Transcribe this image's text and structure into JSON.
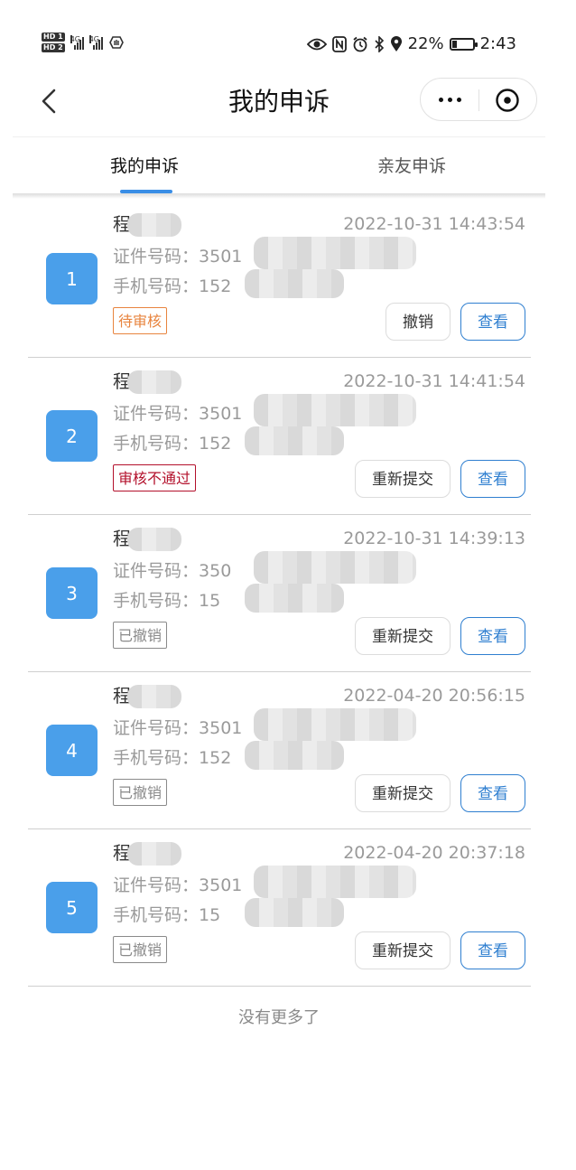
{
  "status_bar": {
    "hd1": "HD 1",
    "hd2": "HD 2",
    "net1": "4G",
    "net2": "4G",
    "battery_percent": "22%",
    "battery_level": 0.22,
    "time": "2:43",
    "icons": [
      "eye-icon",
      "nfc-icon",
      "alarm-icon",
      "bluetooth-icon",
      "location-icon",
      "battery-icon"
    ]
  },
  "nav": {
    "title": "我的申诉",
    "icons": [
      "back-chevron-icon",
      "more-dots-icon",
      "close-circle-icon"
    ]
  },
  "tabs": [
    {
      "label": "我的申诉",
      "active": true
    },
    {
      "label": "亲友申诉",
      "active": false
    }
  ],
  "items": [
    {
      "index": "1",
      "name": "程",
      "time": "2022-10-31 14:43:54",
      "id_label": "证件号码：",
      "id_value": "3501",
      "phone_label": "手机号码：",
      "phone_value": "152",
      "status": "待审核",
      "buttons": [
        "撤销",
        "查看"
      ]
    },
    {
      "index": "2",
      "name": "程",
      "time": "2022-10-31 14:41:54",
      "id_label": "证件号码：",
      "id_value": "3501",
      "phone_label": "手机号码：",
      "phone_value": "152",
      "status": "审核不通过",
      "buttons": [
        "重新提交",
        "查看"
      ]
    },
    {
      "index": "3",
      "name": "程",
      "time": "2022-10-31 14:39:13",
      "id_label": "证件号码：",
      "id_value": "350",
      "phone_label": "手机号码：",
      "phone_value": "15",
      "status": "已撤销",
      "buttons": [
        "重新提交",
        "查看"
      ]
    },
    {
      "index": "4",
      "name": "程",
      "time": "2022-04-20 20:56:15",
      "id_label": "证件号码：",
      "id_value": "3501",
      "phone_label": "手机号码：",
      "phone_value": "152",
      "status": "已撤销",
      "buttons": [
        "重新提交",
        "查看"
      ]
    },
    {
      "index": "5",
      "name": "程",
      "time": "2022-04-20 20:37:18",
      "id_label": "证件号码：",
      "id_value": "3501",
      "phone_label": "手机号码：",
      "phone_value": "15",
      "status": "已撤销",
      "buttons": [
        "重新提交",
        "查看"
      ]
    }
  ],
  "footer": {
    "no_more": "没有更多了"
  },
  "colors": {
    "accent": "#3a8ee6",
    "badge": "#4a9fea",
    "pending": "#e8843e",
    "rejected": "#b3102b",
    "cancelled": "#8a8a8a",
    "view_button": "#2f7fd0"
  }
}
